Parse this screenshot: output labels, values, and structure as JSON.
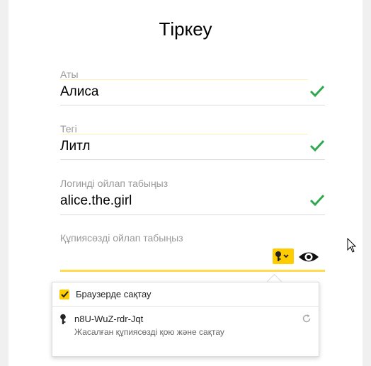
{
  "form": {
    "title": "Тіркеу",
    "fields": [
      {
        "label": "Аты",
        "value": "Алиса",
        "status": "valid"
      },
      {
        "label": "Тегі",
        "value": "Литл",
        "status": "valid"
      },
      {
        "label": "Логинді ойлап табыңыз",
        "value": "alice.the.girl",
        "status": "valid"
      }
    ],
    "password": {
      "label": "Құпиясөзді ойлап табыңыз",
      "value": ""
    }
  },
  "popup": {
    "save_in_browser_label": "Браузерде сақтау",
    "save_in_browser_checked": true,
    "suggested_password": "n8U-WuZ-rdr-Jqt",
    "suggested_action": "Жасалған құпиясөзді қою және сақтау"
  },
  "colors": {
    "accent": "#ffcc00",
    "valid": "#2fa84f",
    "focus_line": "#ffdb4d"
  },
  "icons": [
    "check-icon",
    "key-icon",
    "chevron-down-icon",
    "eye-icon",
    "refresh-icon",
    "mouse-cursor-icon"
  ]
}
